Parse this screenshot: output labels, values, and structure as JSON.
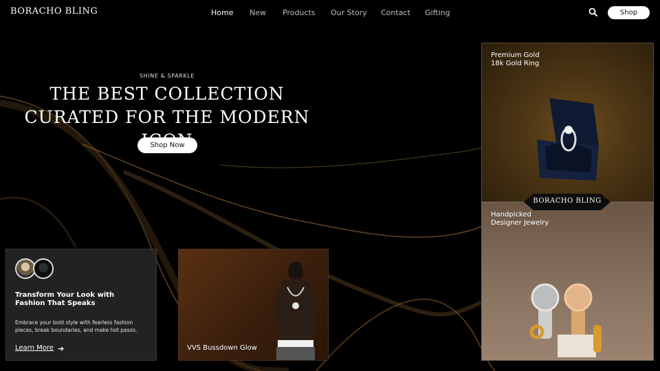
{
  "brand": {
    "logo": "BORACHO BLING"
  },
  "nav": {
    "items": [
      {
        "label": "Home",
        "active": true
      },
      {
        "label": "New",
        "active": false
      },
      {
        "label": "Products",
        "active": false
      },
      {
        "label": "Our Story",
        "active": false
      },
      {
        "label": "Contact",
        "active": false
      },
      {
        "label": "Gifting",
        "active": false
      }
    ],
    "search_icon": "search-icon",
    "shop_label": "Shop"
  },
  "hero": {
    "eyebrow": "SHINE & SPARKLE",
    "headline_line1": "The Best Collection",
    "headline_line2": "Curated for the Modern Icon",
    "cta": "Shop Now"
  },
  "card_fashion": {
    "title": "Transform Your Look with Fashion That Speaks",
    "text": "Embrace your bold style with fearless fashion pieces, break boundaries, and make hot pasos.",
    "link": "Learn More",
    "arrow_icon": "arrow-right-icon"
  },
  "card_vvs": {
    "label": "VVS Bussdown Glow"
  },
  "card_ring": {
    "line1": "Premium Gold",
    "line2": "18k Gold Ring"
  },
  "card_watches": {
    "line1": "Handpicked",
    "line2": "Designer Jewelry"
  },
  "badge": {
    "text": "BORACHO BLING"
  },
  "colors": {
    "background": "#000000",
    "accent_gold": "#8a6a3a",
    "button_bg": "#ffffff"
  }
}
